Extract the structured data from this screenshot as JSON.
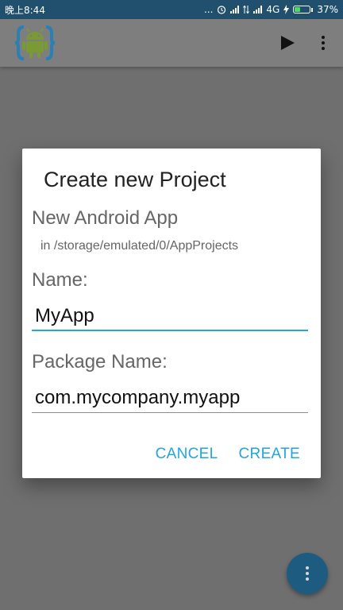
{
  "status_bar": {
    "time": "晚上8:44",
    "dots": "...",
    "network": "4G",
    "battery_percent": "37%",
    "battery_level": 0.37
  },
  "toolbar": {
    "logo_icon": "android-braces-logo-icon",
    "run_icon": "play-icon",
    "menu_icon": "more-vert-icon"
  },
  "dialog": {
    "title": "Create new Project",
    "app_type": "New Android App",
    "location": "in /storage/emulated/0/AppProjects",
    "name_label": "Name:",
    "name_value": "MyApp",
    "package_label": "Package Name:",
    "package_value": "com.mycompany.myapp",
    "cancel_label": "CANCEL",
    "create_label": "CREATE"
  },
  "colors": {
    "accent": "#1ea7e4",
    "status_bar": "#20506e",
    "fab": "#1d5c80",
    "scrim": "#6f6f6f"
  }
}
